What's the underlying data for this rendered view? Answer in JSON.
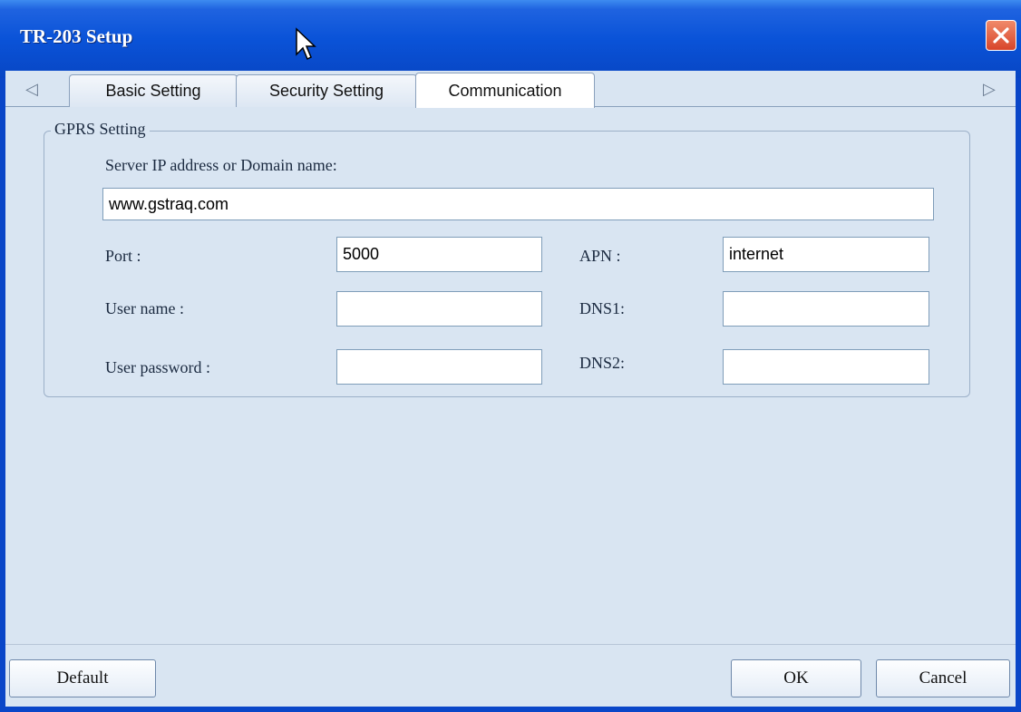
{
  "window": {
    "title": "TR-203 Setup"
  },
  "tabs": [
    {
      "label": "Basic Setting"
    },
    {
      "label": "Security Setting"
    },
    {
      "label": "Communication"
    }
  ],
  "active_tab": "Communication",
  "icons": {
    "close": "close-icon",
    "scroll_left": "triangle-left-icon",
    "scroll_right": "triangle-right-icon",
    "cursor": "mouse-cursor-icon"
  },
  "gprs": {
    "legend": "GPRS Setting",
    "server_label": "Server IP address or Domain name:",
    "server_value": "www.gstraq.com",
    "port_label": "Port :",
    "port_value": "5000",
    "apn_label": "APN :",
    "apn_value": "internet",
    "username_label": "User name :",
    "username_value": "",
    "dns1_label": "DNS1:",
    "dns1_value": "",
    "password_label": "User password :",
    "password_value": "",
    "dns2_label": "DNS2:",
    "dns2_value": ""
  },
  "buttons": {
    "default": "Default",
    "ok": "OK",
    "cancel": "Cancel"
  },
  "colors": {
    "titlebar": "#0a53d8",
    "client": "#d9e5f2",
    "close": "#d8452a"
  }
}
